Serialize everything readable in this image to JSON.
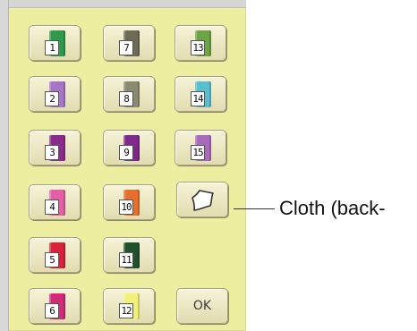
{
  "spools": [
    {
      "number": "1",
      "color": "#2f9a4a"
    },
    {
      "number": "7",
      "color": "#6d6b56"
    },
    {
      "number": "13",
      "color": "#6fa446"
    },
    {
      "number": "2",
      "color": "#a675c6"
    },
    {
      "number": "8",
      "color": "#8b8a72"
    },
    {
      "number": "14",
      "color": "#59bfcf"
    },
    {
      "number": "3",
      "color": "#8a2c8e"
    },
    {
      "number": "9",
      "color": "#7d2a8b"
    },
    {
      "number": "15",
      "color": "#a86abb"
    },
    {
      "number": "4",
      "color": "#e65fa6"
    },
    {
      "number": "10",
      "color": "#e8702f"
    },
    {
      "number": "5",
      "color": "#d8213b"
    },
    {
      "number": "11",
      "color": "#20502c"
    },
    {
      "number": "6",
      "color": "#cf2b78"
    },
    {
      "number": "12",
      "color": "#f2f07a"
    }
  ],
  "cloth_button": {
    "icon": "cloth-icon"
  },
  "ok_button": {
    "label": "OK"
  },
  "callout": {
    "text": "Cloth (back-"
  }
}
